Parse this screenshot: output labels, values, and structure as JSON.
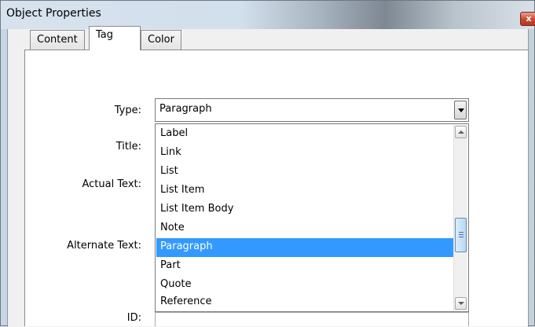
{
  "window": {
    "title": "Object Properties",
    "close_glyph": "x"
  },
  "tabs": [
    {
      "label": "Content",
      "active": false
    },
    {
      "label": "Tag",
      "active": true
    },
    {
      "label": "Color",
      "active": false
    }
  ],
  "form": {
    "type_label": "Type:",
    "title_label": "Title:",
    "actual_text_label": "Actual Text:",
    "alternate_text_label": "Alternate Text:",
    "id_label": "ID:",
    "type_value": "Paragraph"
  },
  "dropdown": {
    "options": [
      "Label",
      "Link",
      "List",
      "List Item",
      "List Item Body",
      "Note",
      "Paragraph",
      "Part",
      "Quote",
      "Reference"
    ],
    "selected": "Paragraph"
  },
  "colors": {
    "selection": "#3399ff",
    "panel": "#ffffff",
    "chrome": "#f0f0f0"
  },
  "icons": [
    "close-icon",
    "chevron-down-icon",
    "scroll-up-icon",
    "scroll-down-icon"
  ]
}
